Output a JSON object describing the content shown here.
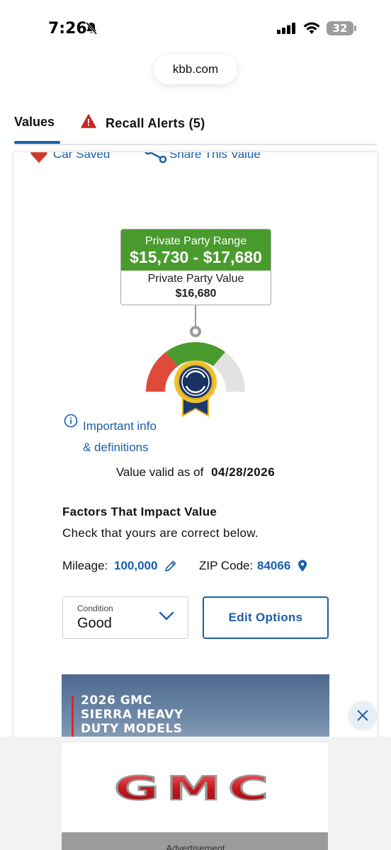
{
  "status_bar": {
    "time": "7:26",
    "battery": "32"
  },
  "browser": {
    "url": "kbb.com"
  },
  "tabs": {
    "values_label": "Values",
    "recall_label": "Recall Alerts (5)"
  },
  "actions": {
    "car_saved": "Car Saved",
    "share_value": "Share This Value"
  },
  "valuation": {
    "range_label": "Private Party Range",
    "range_value": "$15,730 - $17,680",
    "value_label": "Private Party Value",
    "value": "$16,680"
  },
  "info": {
    "link_line1": "Important info",
    "link_line2": "& definitions"
  },
  "valid": {
    "label": "Value valid as of",
    "date": "04/28/2026"
  },
  "factors": {
    "title": "Factors That Impact Value",
    "subtitle": "Check that yours are correct below.",
    "mileage_label": "Mileage:",
    "mileage_value": "100,000",
    "zip_label": "ZIP Code:",
    "zip_value": "84066"
  },
  "condition": {
    "label": "Condition",
    "value": "Good"
  },
  "edit_options": "Edit Options",
  "ad": {
    "headline_line1": "2026 GMC",
    "headline_line2": "SIERRA HEAVY",
    "headline_line3": "DUTY MODELS",
    "brand": "GMC",
    "label": "Advertisement"
  },
  "colors": {
    "link_blue": "#1a5fa8",
    "range_green": "#4a9b2d",
    "gauge_red": "#e04a3b",
    "warning_red": "#c62828"
  }
}
